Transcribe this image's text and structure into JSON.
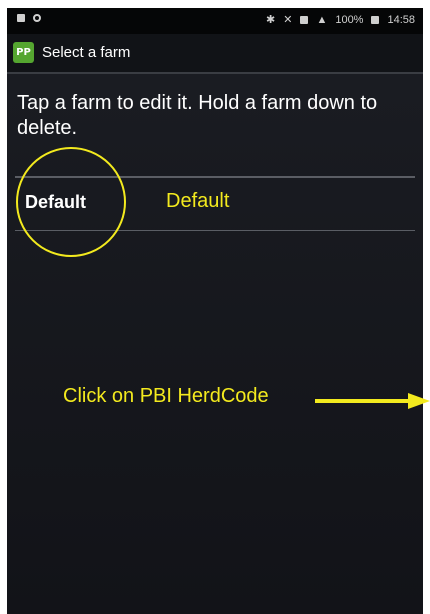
{
  "status_bar": {
    "battery": "100%",
    "time": "14:58"
  },
  "action_bar": {
    "app_icon_text": "PP",
    "title": "Select a farm"
  },
  "main": {
    "instructions": "Tap a farm to edit it. Hold a farm down to delete.",
    "farms": [
      {
        "name": "Default"
      }
    ]
  },
  "annotations": {
    "label": "Default",
    "instruction": "Click on PBI HerdCode",
    "color": "#f3ea1e"
  }
}
